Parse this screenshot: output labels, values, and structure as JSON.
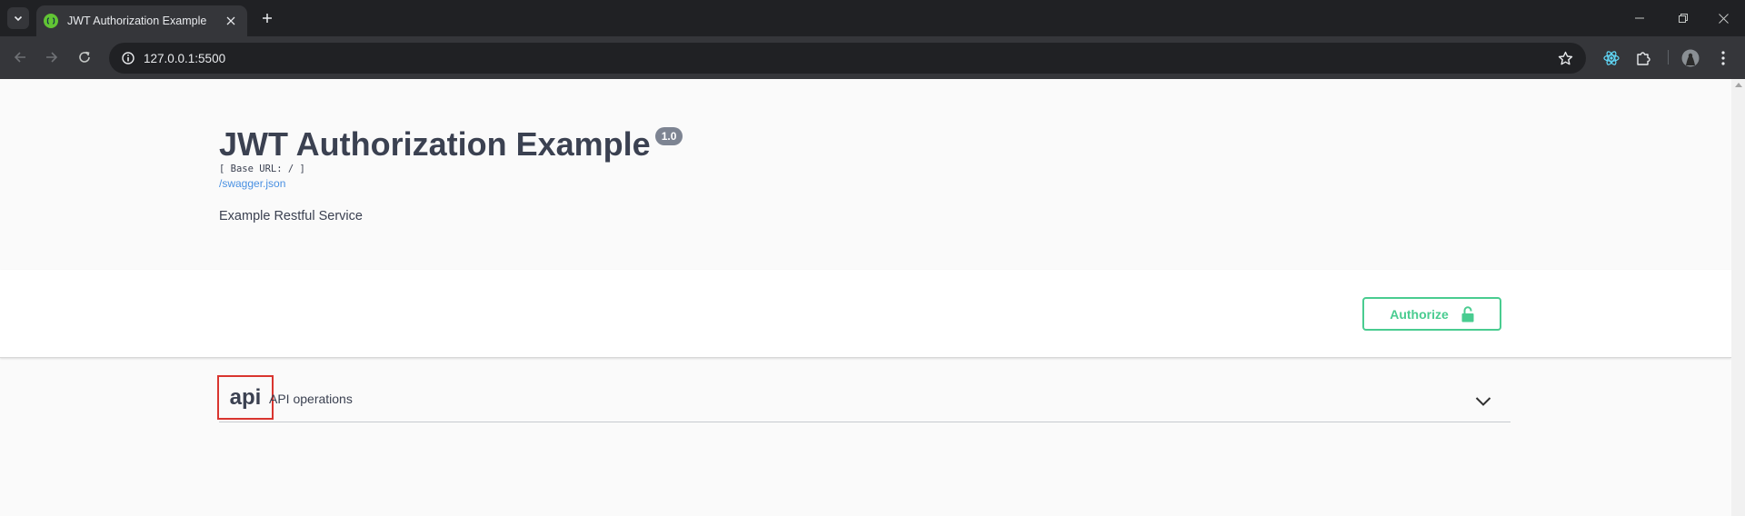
{
  "browser": {
    "tab_title": "JWT Authorization Example",
    "url": "127.0.0.1:5500"
  },
  "info": {
    "title": "JWT Authorization Example",
    "version": "1.0",
    "base_url": "[ Base URL: / ]",
    "spec_link": "/swagger.json",
    "description": "Example Restful Service"
  },
  "scheme": {
    "authorize_label": "Authorize"
  },
  "tags": [
    {
      "name": "api",
      "description": "API operations"
    }
  ],
  "colors": {
    "accent_green": "#49cc90",
    "link_blue": "#4990e2",
    "text_dark": "#3b4151",
    "highlight_red": "#d9352f"
  }
}
